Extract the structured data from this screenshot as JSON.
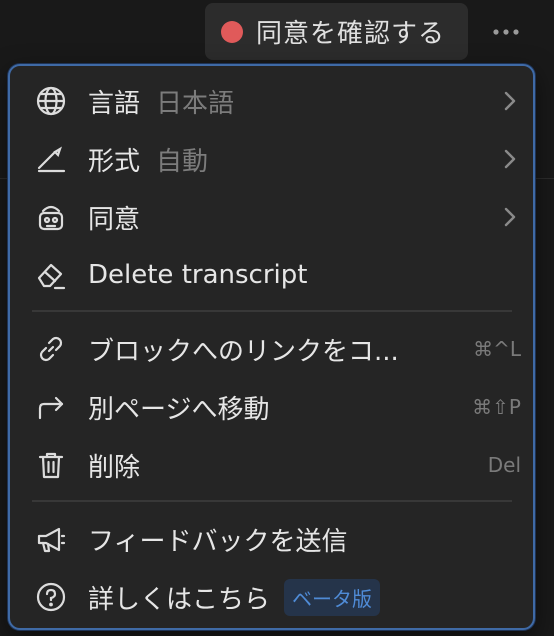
{
  "consent": {
    "label": "同意を確認する",
    "dot_color": "#e05a5a"
  },
  "more": {
    "icon": "ellipsis-icon"
  },
  "menu": {
    "language": {
      "label": "言語",
      "value": "日本語",
      "icon": "globe-icon"
    },
    "format": {
      "label": "形式",
      "value": "自動",
      "icon": "pen-icon"
    },
    "consent": {
      "label": "同意",
      "icon": "consent-icon"
    },
    "delete_transcript": {
      "label": "Delete transcript",
      "icon": "eraser-icon"
    },
    "copy_link": {
      "label": "ブロックへのリンクをコ...",
      "shortcut": "⌘^L",
      "icon": "link-icon"
    },
    "move": {
      "label": "別ページへ移動",
      "shortcut": "⌘⇧P",
      "icon": "arrow-turn-icon"
    },
    "delete": {
      "label": "削除",
      "shortcut": "Del",
      "icon": "trash-icon"
    },
    "feedback": {
      "label": "フィードバックを送信",
      "icon": "megaphone-icon"
    },
    "help": {
      "label": "詳しくはこちら",
      "badge": "ベータ版",
      "icon": "question-circle-icon"
    }
  },
  "colors": {
    "accent_border": "#3f6aa6",
    "badge_text": "#4f8bd6",
    "menu_bg": "#252525"
  }
}
